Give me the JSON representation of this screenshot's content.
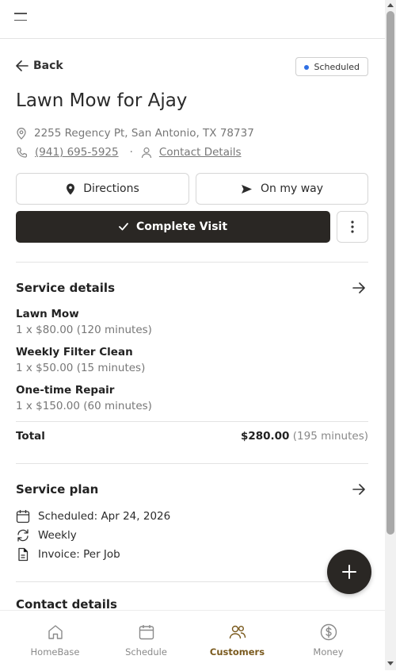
{
  "header": {
    "menu_icon": "hamburger-menu-icon"
  },
  "nav": {
    "back_label": "Back",
    "status_badge": "Scheduled",
    "status_color": "#2f6fe4"
  },
  "visit": {
    "title": "Lawn Mow for Ajay",
    "address": "2255 Regency Pt, San Antonio, TX 78737",
    "phone": "(941) 695-5925",
    "separator": "·",
    "contact_link": "Contact Details"
  },
  "actions": {
    "directions": "Directions",
    "on_my_way": "On my way",
    "complete_visit": "Complete Visit"
  },
  "service_details": {
    "title": "Service details",
    "items": [
      {
        "name": "Lawn Mow",
        "detail": "1 x $80.00 (120 minutes)"
      },
      {
        "name": "Weekly Filter Clean",
        "detail": "1 x $50.00 (15 minutes)"
      },
      {
        "name": "One-time Repair",
        "detail": "1 x $150.00 (60 minutes)"
      }
    ],
    "total_label": "Total",
    "total_amount": "$280.00",
    "total_minutes": "(195 minutes)"
  },
  "service_plan": {
    "title": "Service plan",
    "scheduled": "Scheduled: Apr 24, 2026",
    "frequency": "Weekly",
    "invoice": "Invoice: Per Job"
  },
  "contact_section": {
    "title": "Contact details"
  },
  "bottom_nav": {
    "items": [
      {
        "label": "HomeBase",
        "icon": "home-icon"
      },
      {
        "label": "Schedule",
        "icon": "calendar-icon"
      },
      {
        "label": "Customers",
        "icon": "customers-icon"
      },
      {
        "label": "Money",
        "icon": "dollar-icon"
      }
    ],
    "active_color": "#7a5a1e"
  },
  "theme": {
    "primary_dark": "#2a2724"
  }
}
